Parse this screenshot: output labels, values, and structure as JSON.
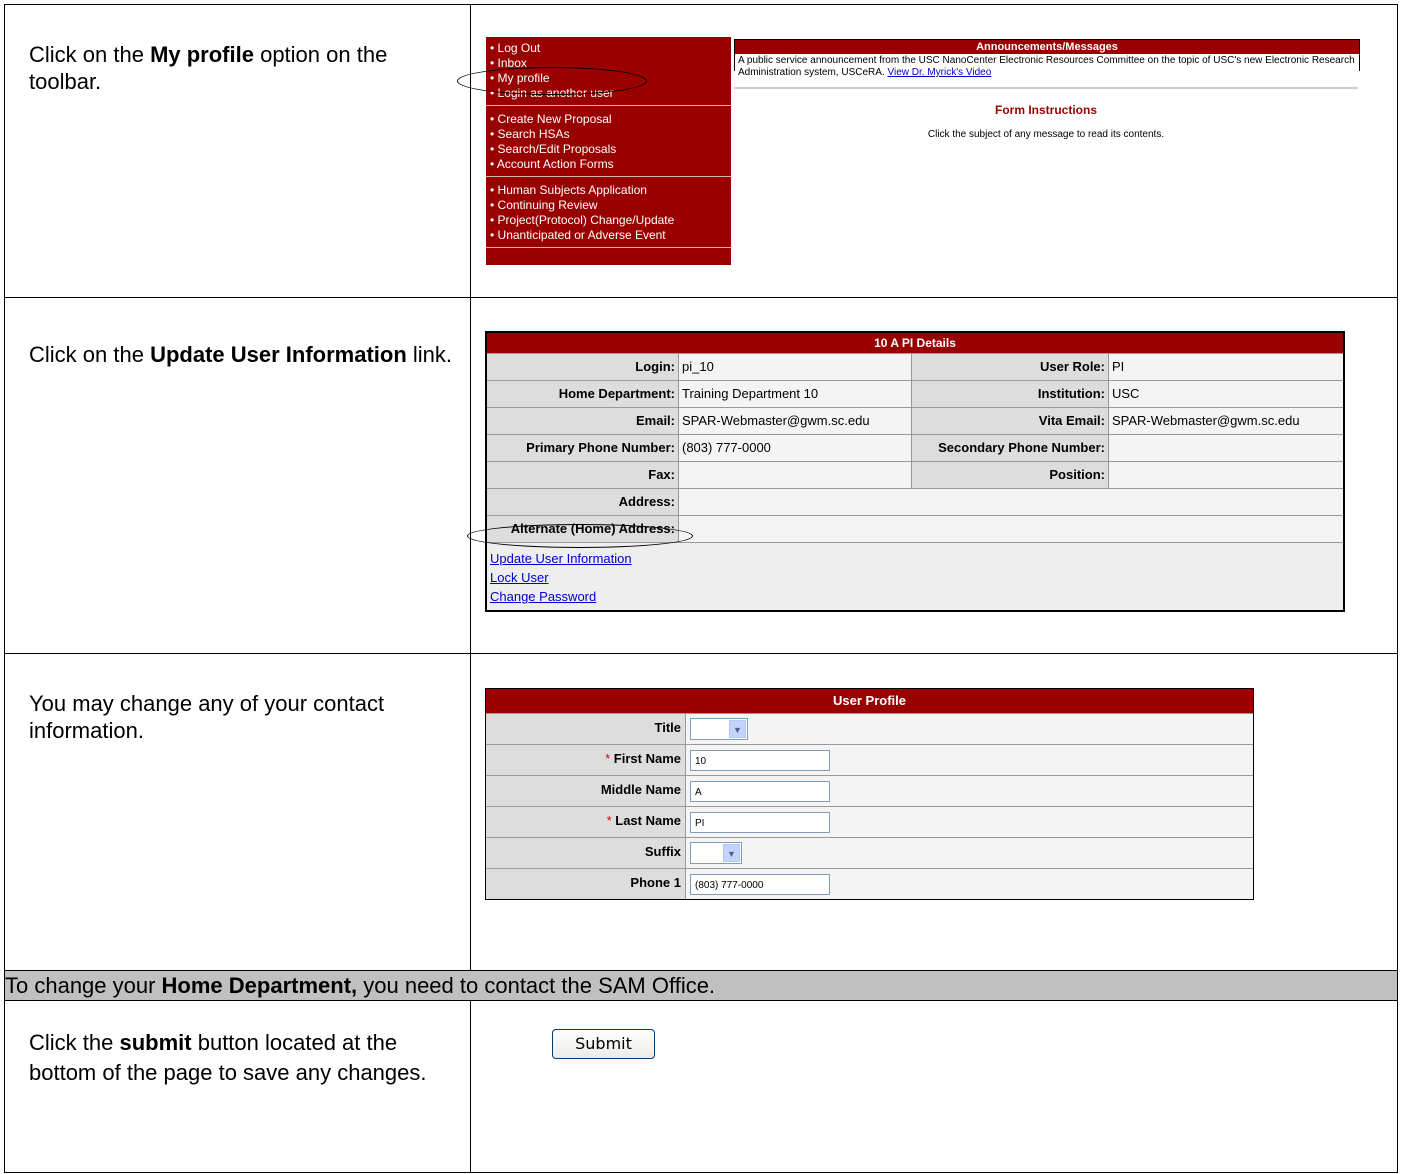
{
  "steps": {
    "s1": {
      "pre": "Click on the ",
      "bold": "My profile",
      "post": " option on the toolbar."
    },
    "s2": {
      "pre": "Click on the ",
      "bold": "Update User Information",
      "post": " link."
    },
    "s3": {
      "text": "You may change any of your contact information."
    },
    "band": {
      "pre": "To change your ",
      "bold": "Home Department,",
      "post": " you need to contact the SAM Office."
    },
    "s5": {
      "pre": "Click the ",
      "bold": "submit",
      "post": " button located at the bottom of the page to save any changes."
    }
  },
  "menu": {
    "group1": [
      "• Log Out",
      "• Inbox",
      "• My profile",
      "• Login as another user"
    ],
    "group2": [
      "• Create New Proposal",
      "• Search HSAs",
      "• Search/Edit Proposals",
      "• Account Action Forms"
    ],
    "group3": [
      "• Human Subjects Application",
      "• Continuing Review",
      "• Project(Protocol) Change/Update",
      "• Unanticipated or Adverse Event"
    ]
  },
  "announcements": {
    "title": "Announcements/Messages",
    "text": "A public service announcement from the USC NanoCenter Electronic Resources Committee on the topic of USC's new Electronic Research Administration system, USCeRA.",
    "link": "View Dr. Myrick's Video"
  },
  "form_instructions": {
    "title": "Form Instructions",
    "text": "Click the subject of any message to read its contents."
  },
  "pi_details": {
    "title": "10 A PI Details",
    "login_label": "Login:",
    "login": "pi_10",
    "role_label": "User Role:",
    "role": "PI",
    "dept_label": "Home Department:",
    "dept": "Training Department 10",
    "inst_label": "Institution:",
    "inst": "USC",
    "email_label": "Email:",
    "email": "SPAR-Webmaster@gwm.sc.edu",
    "vita_label": "Vita Email:",
    "vita": "SPAR-Webmaster@gwm.sc.edu",
    "phone1_label": "Primary Phone Number:",
    "phone1": "(803) 777-0000",
    "phone2_label": "Secondary Phone Number:",
    "phone2": "",
    "fax_label": "Fax:",
    "fax": "",
    "position_label": "Position:",
    "position": "",
    "address_label": "Address:",
    "address": "",
    "alt_address_label": "Alternate (Home) Address:",
    "alt_address": "",
    "links": [
      "Update User Information",
      "Lock User",
      "Change Password"
    ]
  },
  "user_profile": {
    "title": "User Profile",
    "required_mark": "*",
    "title_label": "Title",
    "first_label": "First Name",
    "first": "10",
    "middle_label": "Middle Name",
    "middle": "A",
    "last_label": "Last Name",
    "last": "PI",
    "suffix_label": "Suffix",
    "phone_label": "Phone 1",
    "phone": "(803) 777-0000"
  },
  "submit": {
    "label": "Submit"
  }
}
